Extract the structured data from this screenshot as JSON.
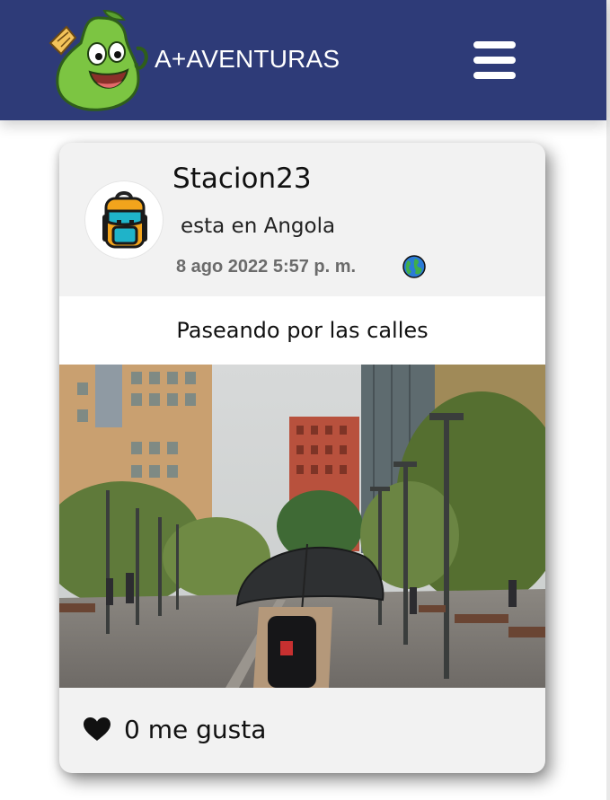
{
  "header": {
    "brand": "A+AVENTURAS",
    "logo_icon": "green-pear-mascot-icon",
    "menu_icon": "hamburger-menu-icon",
    "background_color": "#2e3b78"
  },
  "post": {
    "username": "Stacion23",
    "avatar_icon": "backpack-icon",
    "location_text": "esta en Angola",
    "date_text": "8 ago 2022 5:57 p. m.",
    "visibility_icon": "globe-icon",
    "caption": "Paseando por las calles",
    "photo_icon": "street-photo-umbrella",
    "likes": {
      "icon": "heart-icon",
      "label": "0 me gusta"
    }
  }
}
